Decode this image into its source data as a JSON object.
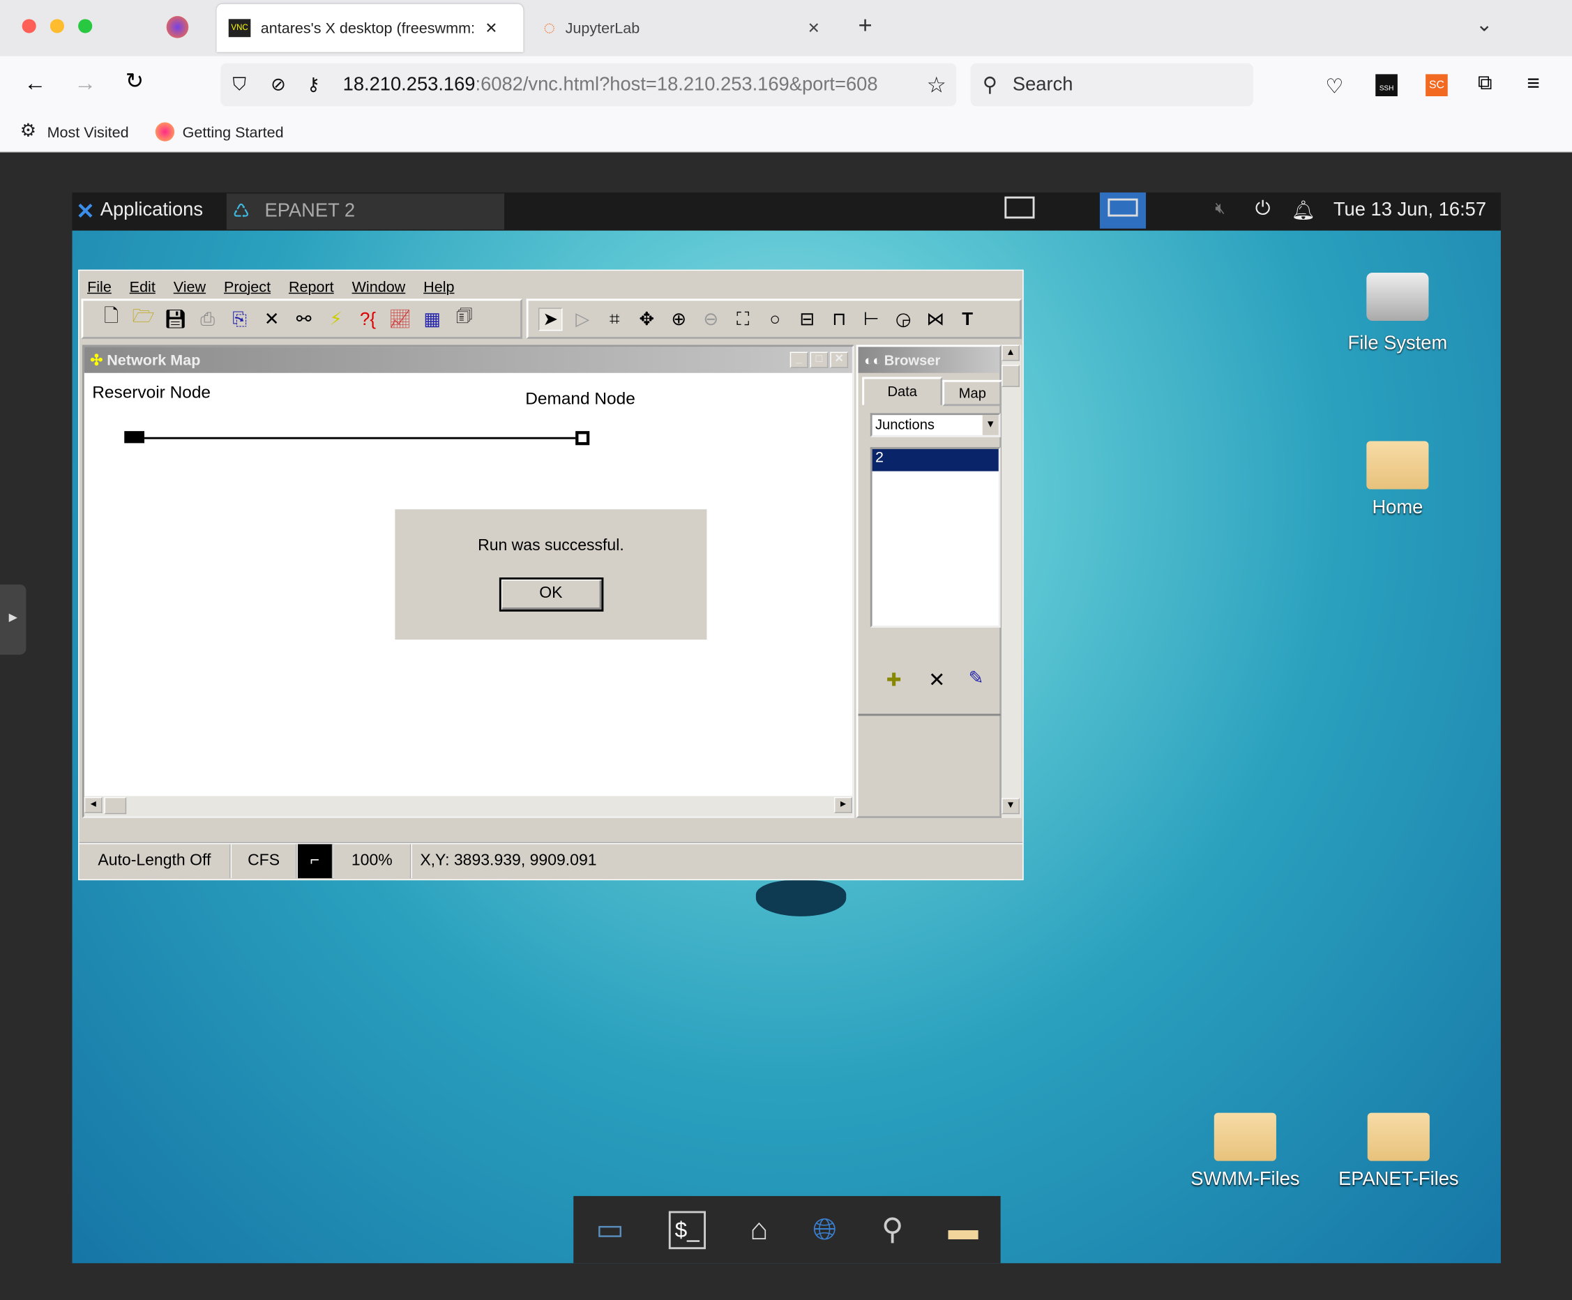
{
  "browser": {
    "tabs": [
      {
        "label": "antares's X desktop (freeswmm:",
        "icon": "vnc-icon"
      },
      {
        "label": "JupyterLab",
        "icon": "jupyter-icon"
      }
    ],
    "url_host": "18.210.253.169",
    "url_rest": ":6082/vnc.html?host=18.210.253.169&port=608",
    "search_placeholder": "Search",
    "bookmarks": [
      "Most Visited",
      "Getting Started"
    ],
    "ext_ssh": "SSH",
    "ext_sc": "SC"
  },
  "panel": {
    "applications": "Applications",
    "task": "EPANET 2",
    "clock": "Tue 13 Jun, 16:57"
  },
  "epanet": {
    "menu": [
      "File",
      "Edit",
      "View",
      "Project",
      "Report",
      "Window",
      "Help"
    ],
    "network_map": {
      "title": "Network Map",
      "reservoir_label": "Reservoir Node",
      "demand_label": "Demand Node"
    },
    "dialog": {
      "message": "Run was successful.",
      "ok": "OK"
    },
    "browser": {
      "title": "Browser",
      "tabs": [
        "Data",
        "Map"
      ],
      "select": "Junctions",
      "items": [
        "2"
      ]
    },
    "status": {
      "auto_length": "Auto-Length Off",
      "units": "CFS",
      "zoom": "100%",
      "xy": "X,Y: 3893.939, 9909.091"
    }
  },
  "desktop": {
    "icons": [
      "File System",
      "Home",
      "SWMM-Files",
      "EPANET-Files"
    ]
  },
  "colors": {
    "desktop": "#2aa0be",
    "selection": "#0a246a",
    "win": "#d4d0c8"
  }
}
